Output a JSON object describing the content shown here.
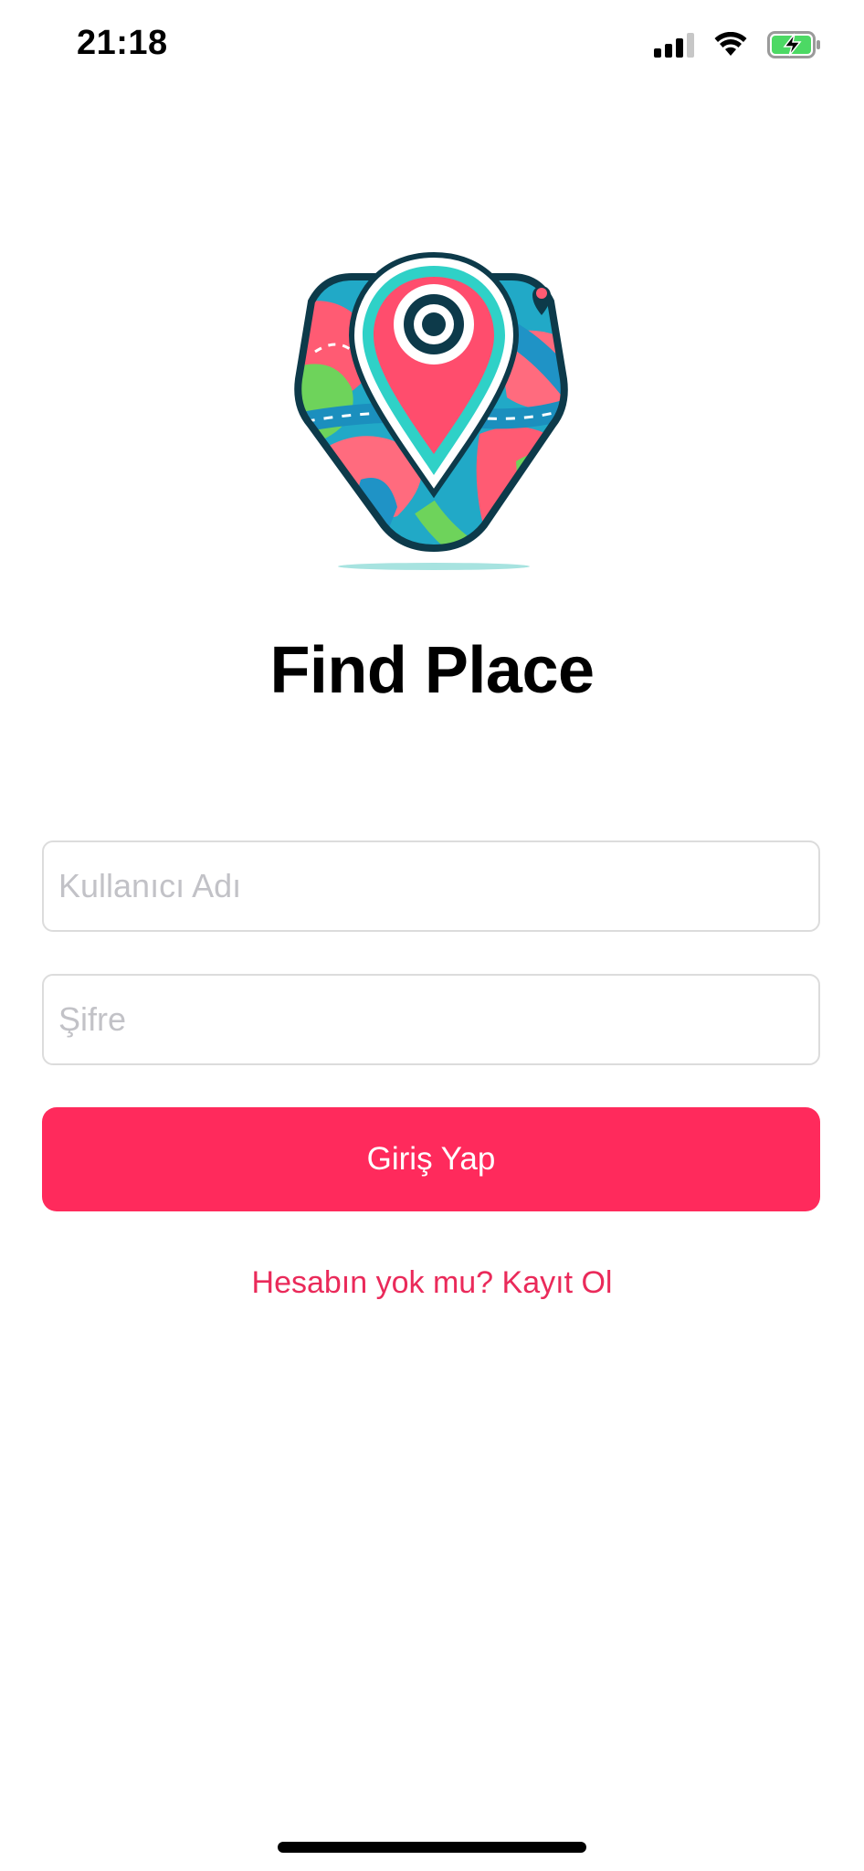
{
  "status_bar": {
    "time": "21:18",
    "icons": [
      "cellular-signal-icon",
      "wifi-icon",
      "battery-charging-icon"
    ]
  },
  "logo": {
    "icon": "map-pin-icon"
  },
  "app": {
    "title": "Find Place"
  },
  "login_form": {
    "username_placeholder": "Kullanıcı Adı",
    "username_value": "",
    "password_placeholder": "Şifre",
    "password_value": "",
    "login_button_label": "Giriş Yap",
    "register_link_label": "Hesabın yok mu? Kayıt Ol"
  },
  "colors": {
    "accent": "#ff2a5c",
    "link": "#ea2a5a",
    "battery": "#4cd964"
  }
}
